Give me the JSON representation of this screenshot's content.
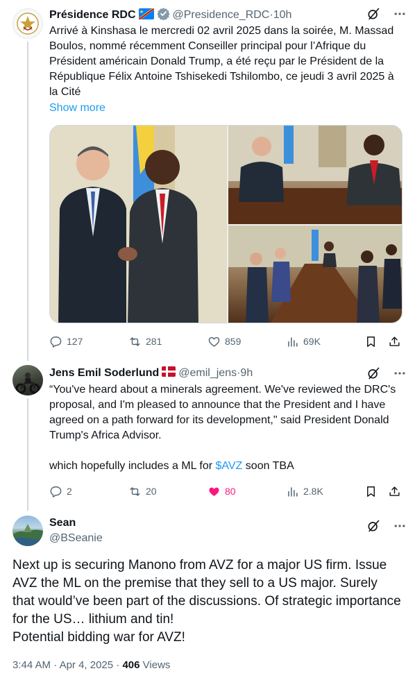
{
  "tweets": [
    {
      "author": "Présidence RDC",
      "handle": "@Presidence_RDC",
      "time": "10h",
      "text": "Arrivé à Kinshasa le mercredi 02 avril 2025 dans la soirée, M. Massad Boulos, nommé récemment Conseiller principal pour l’Afrique du Président américain Donald Trump, a été reçu par le Président de la République Félix Antoine Tshisekedi Tshilombo, ce jeudi 3 avril 2025 à la Cité",
      "show_more": "Show more",
      "stats": {
        "replies": "127",
        "reposts": "281",
        "likes": "859",
        "views": "69K"
      }
    },
    {
      "author": "Jens Emil Soderlund",
      "handle": "@emil_jens",
      "time": "9h",
      "text": "“You've heard about a minerals agreement. We've reviewed the DRC's proposal, and I'm pleased to announce that the President and I have agreed on a path forward for its development,\" said President Donald Trump's Africa Advisor.",
      "text2_before": "which hopefully includes a ML for ",
      "text2_link": "$AVZ",
      "text2_after": " soon TBA",
      "stats": {
        "replies": "2",
        "reposts": "20",
        "likes": "80",
        "views": "2.8K"
      }
    }
  ],
  "main_tweet": {
    "author": "Sean",
    "handle": "@BSeanie",
    "text_lines": [
      "Next up is securing Manono from AVZ for a major US firm. Issue AVZ the ML on the premise that they sell to a US major. Surely that would’ve been part of the discussions. Of strategic importance for the US… lithium and tin!",
      "Potential bidding war for AVZ!"
    ],
    "time": "3:44 AM",
    "date": "Apr 4, 2025",
    "views_count": "406",
    "views_label": "Views"
  },
  "separator": " · ",
  "colors": {
    "accent": "#1d9bf0",
    "like_active": "#f91880",
    "muted": "#536471"
  }
}
